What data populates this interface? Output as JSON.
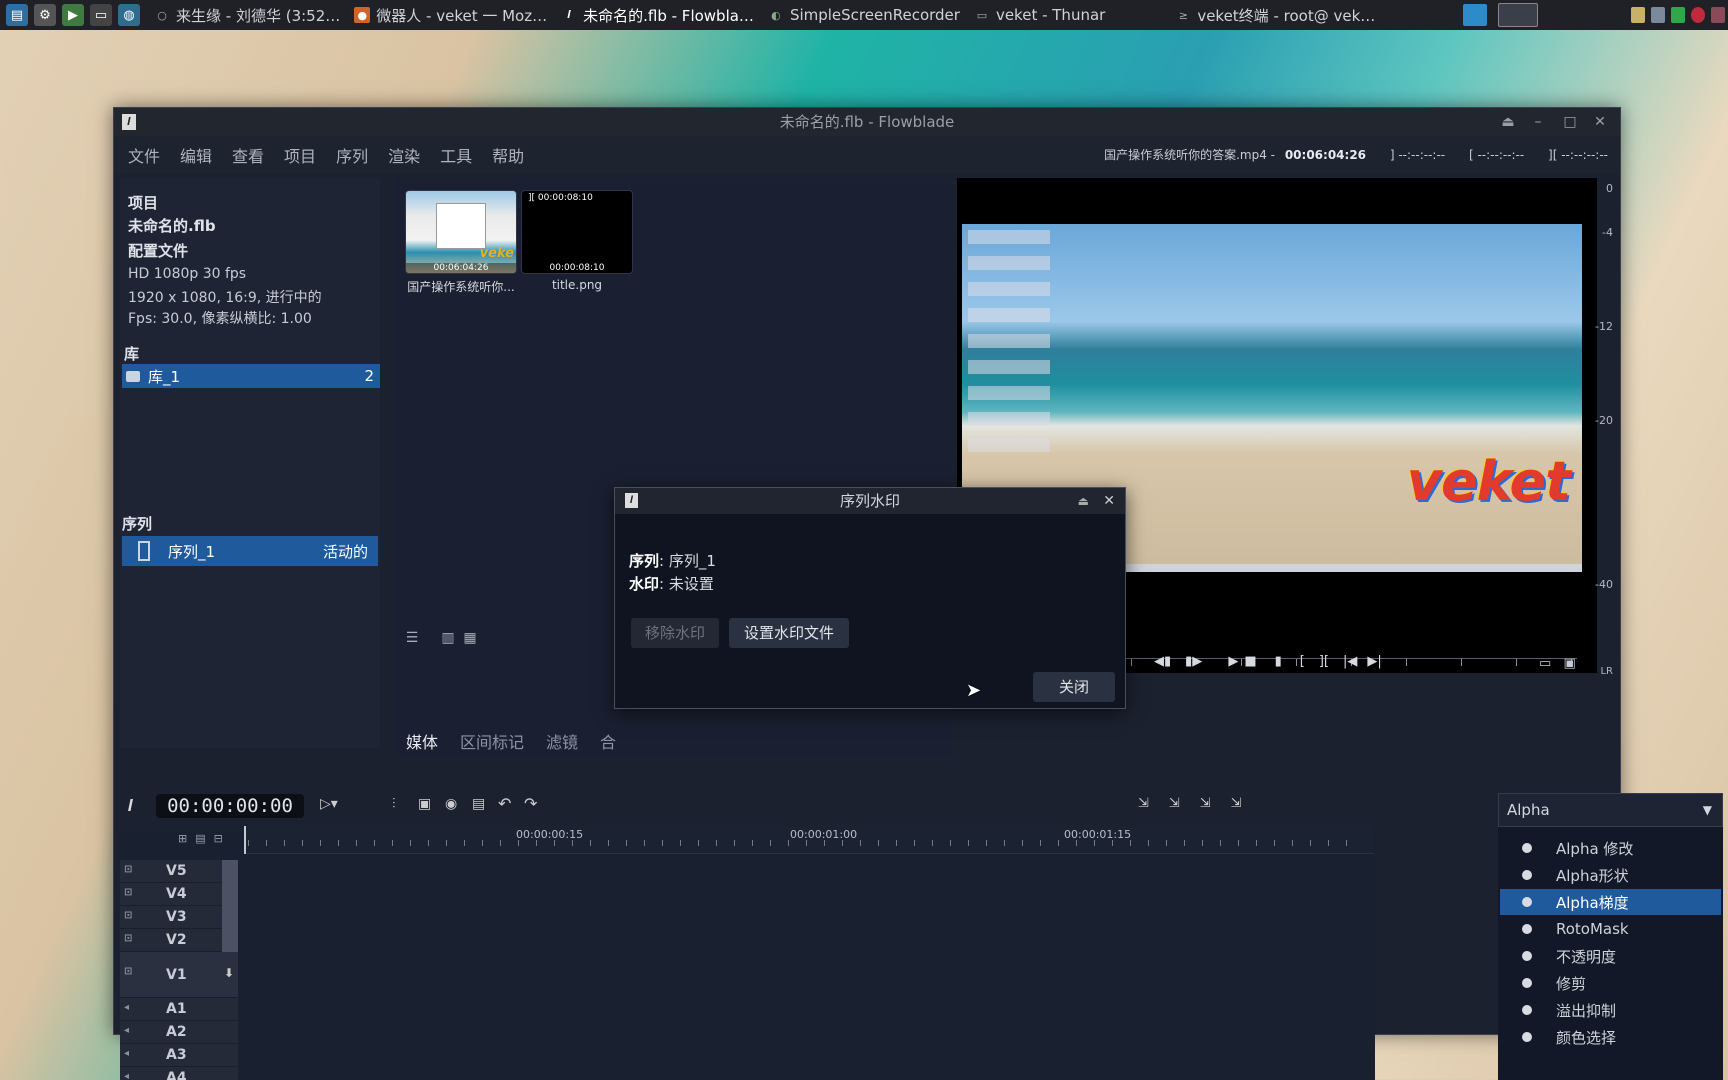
{
  "taskbar": {
    "tasks": [
      {
        "label": "来生缘 - 刘德华 (3:52…"
      },
      {
        "label": "微器人 - veket 一 Moz…"
      },
      {
        "label": "未命名的.flb - Flowbla…"
      },
      {
        "label": "SimpleScreenRecorder"
      },
      {
        "label": "veket - Thunar"
      },
      {
        "label": "veket终端 - root@ vek…"
      }
    ]
  },
  "window": {
    "title": "未命名的.flb - Flowblade",
    "menu": [
      "文件",
      "编辑",
      "查看",
      "项目",
      "序列",
      "渲染",
      "工具",
      "帮助"
    ],
    "monitor_info": {
      "clip": "国产操作系统听你的答案.mp4 -",
      "timecode": "00:06:04:26",
      "mark_in": "] --:--:--:--",
      "mark_out": "[ --:--:--:--",
      "length": "][ --:--:--:--"
    }
  },
  "project": {
    "heading": "项目",
    "name": "未命名的.flb",
    "profile_heading": "配置文件",
    "profile_line1": "HD 1080p 30 fps",
    "profile_line2": "1920 x 1080, 16:9, 进行中的",
    "profile_line3": "Fps: 30.0, 像素纵横比: 1.00",
    "bins_heading": "库",
    "bin": {
      "name": "库_1",
      "count": "2"
    },
    "sequences_heading": "序列",
    "sequence": {
      "name": "序列_1",
      "status": "活动的"
    }
  },
  "media": {
    "clips": [
      {
        "name": "国产操作系统听你...",
        "duration": "00:06:04:26",
        "overlay": "veke"
      },
      {
        "name": "title.png",
        "duration": "00:00:08:10",
        "top": "][ 00:00:08:10"
      }
    ],
    "tabs": [
      "媒体",
      "区间标记",
      "滤镜",
      "合"
    ]
  },
  "monitor": {
    "watermark_text": "veket",
    "scale": [
      "0",
      "-4",
      "-12",
      "-20",
      "-40"
    ],
    "lr": "LR"
  },
  "dialog": {
    "title": "序列水印",
    "seq_label": "序列",
    "seq_value": ": 序列_1",
    "wm_label": "水印",
    "wm_value": ": 未设置",
    "remove_button": "移除水印",
    "set_button": "设置水印文件",
    "close_button": "关闭"
  },
  "timeline": {
    "timecode": "00:00:00:00",
    "ruler_labels": [
      "00:00:00:15",
      "00:00:01:00",
      "00:00:01:15"
    ],
    "tracks": [
      "V5",
      "V4",
      "V3",
      "V2",
      "V1",
      "A1",
      "A2",
      "A3",
      "A4"
    ]
  },
  "filters": {
    "category": "Alpha",
    "items": [
      "Alpha 修改",
      "Alpha形状",
      "Alpha梯度",
      "RotoMask",
      "不透明度",
      "修剪",
      "溢出抑制",
      "颜色选择"
    ],
    "selected_index": 2
  }
}
